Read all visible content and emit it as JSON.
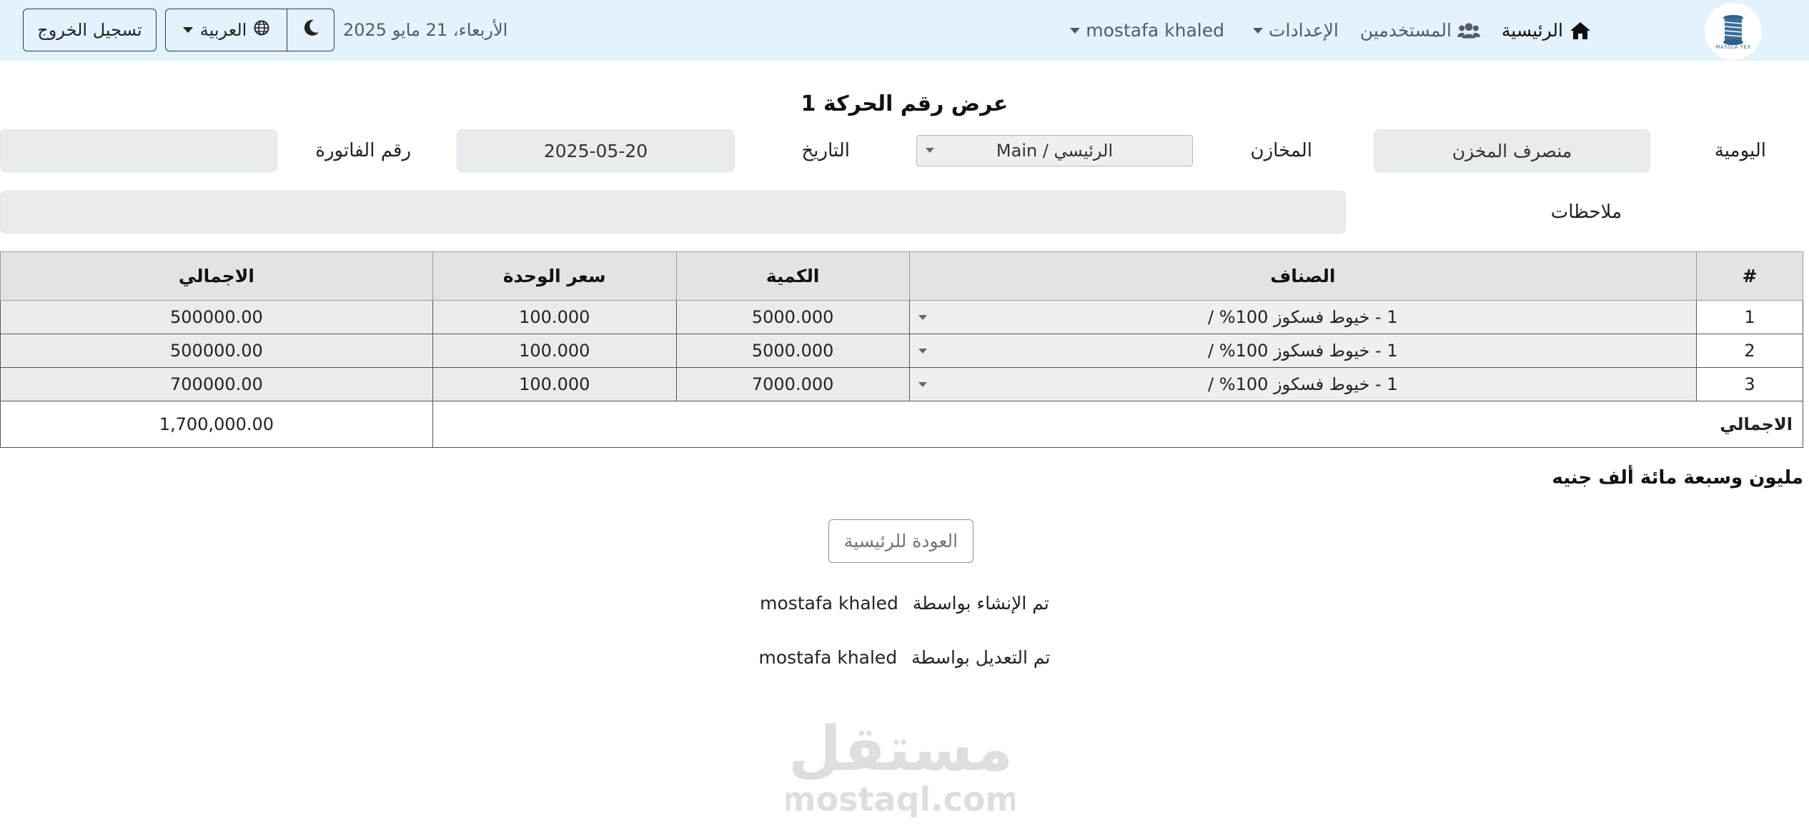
{
  "nav": {
    "home": "الرئيسية",
    "users": "المستخدمين",
    "settings": "الإعدادات",
    "user": "mostafa khaled",
    "date": "الأربعاء، 21 مايو 2025",
    "language": "العربية",
    "logout": "تسجيل الخروج",
    "logo_text": "MASSLA TEX"
  },
  "form": {
    "title": "عرض رقم الحركة 1",
    "journal_label": "اليومية",
    "journal_value": "منصرف المخزن",
    "stores_label": "المخازن",
    "stores_value": "الرئيسي / Main",
    "date_label": "التاريخ",
    "date_value": "2025-05-20",
    "invoice_label": "رقم الفاتورة",
    "invoice_value": "",
    "notes_label": "ملاحظات",
    "notes_value": ""
  },
  "table": {
    "headers": [
      "#",
      "الصناف",
      "الكمية",
      "سعر الوحدة",
      "الاجمالي"
    ],
    "rows": [
      {
        "index": "1",
        "item": "1 - خيوط فسكوز 100% /",
        "qty": "5000.000",
        "price": "100.000",
        "total": "500000.00"
      },
      {
        "index": "2",
        "item": "1 - خيوط فسكوز 100% /",
        "qty": "5000.000",
        "price": "100.000",
        "total": "500000.00"
      },
      {
        "index": "3",
        "item": "1 - خيوط فسكوز 100% /",
        "qty": "7000.000",
        "price": "100.000",
        "total": "700000.00"
      }
    ],
    "total_label": "الاجمالي",
    "total_value": "1,700,000.00"
  },
  "amount_words": "مليون وسبعة مائة ألف جنيه",
  "back_button": "العودة للرئيسية",
  "audit": {
    "created_label": "تم الإنشاء بواسطة",
    "created_by": "mostafa khaled",
    "modified_label": "تم التعديل بواسطة",
    "modified_by": "mostafa khaled"
  },
  "watermark": {
    "arabic": "مستقل",
    "latin": "mostaql.com"
  }
}
